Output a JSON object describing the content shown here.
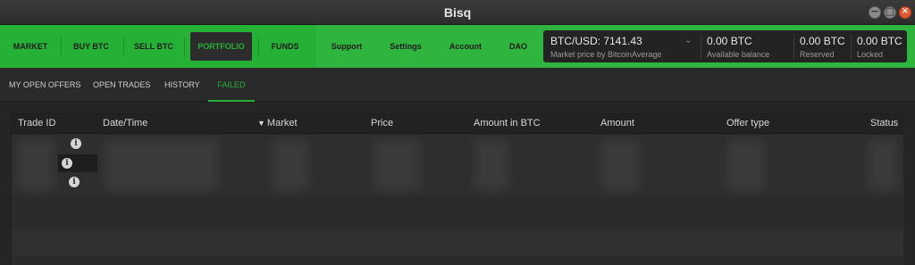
{
  "window": {
    "title": "Bisq",
    "min_icon": "−",
    "max_icon": "□",
    "close_icon": "×"
  },
  "nav": {
    "market": "MARKET",
    "buy_btc": "BUY BTC",
    "sell_btc": "SELL BTC",
    "portfolio": "PORTFOLIO",
    "funds": "FUNDS",
    "support": "Support",
    "settings": "Settings",
    "account": "Account",
    "dao": "DAO"
  },
  "balances": {
    "price": "BTC/USD: 7141.43",
    "price_sub": "Market price by BitcoinAverage",
    "available": "0.00 BTC",
    "available_sub": "Available balance",
    "reserved": "0.00 BTC",
    "reserved_sub": "Reserved",
    "locked": "0.00 BTC",
    "locked_sub": "Locked"
  },
  "subtabs": {
    "open_offers": "MY OPEN OFFERS",
    "open_trades": "OPEN TRADES",
    "history": "HISTORY",
    "failed": "FAILED"
  },
  "table": {
    "columns": {
      "trade_id": "Trade ID",
      "date_time": "Date/Time",
      "market": "Market",
      "price": "Price",
      "amount_btc": "Amount in BTC",
      "amount": "Amount",
      "offer_type": "Offer type",
      "status": "Status"
    },
    "sort_indicator": "▼",
    "info_glyph": "i"
  },
  "colors": {
    "accent": "#25b135",
    "background": "#252525",
    "panel": "#232323"
  }
}
